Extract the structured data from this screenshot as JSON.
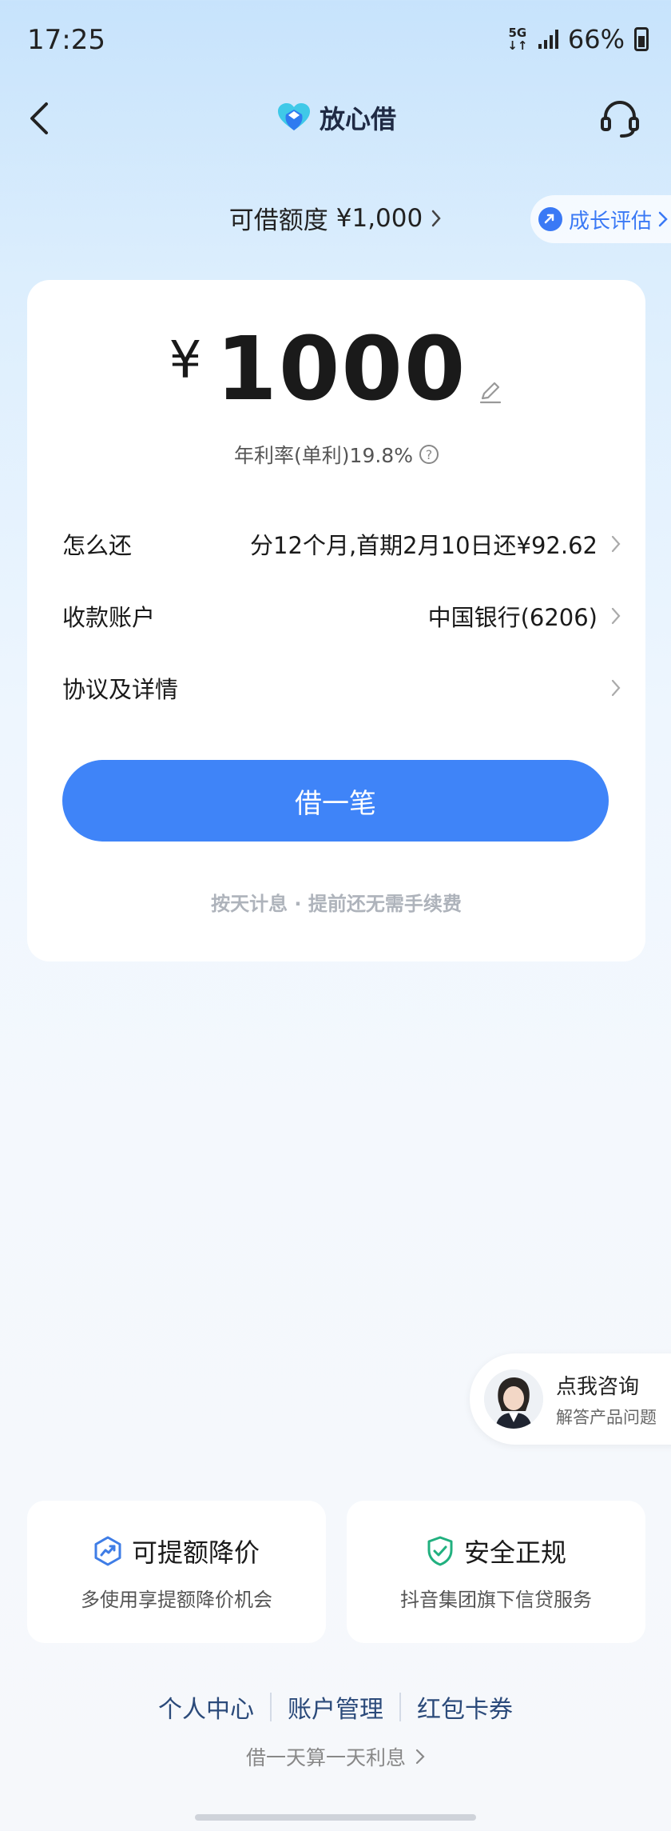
{
  "status": {
    "time": "17:25",
    "network": "5G",
    "battery": "66%"
  },
  "nav": {
    "title": "放心借",
    "back_icon": "chevron-left-icon",
    "service_icon": "headset-icon"
  },
  "quota": {
    "label": "可借额度",
    "amount": "¥1,000",
    "growth_label": "成长评估"
  },
  "loan": {
    "currency": "¥",
    "amount": "1000",
    "rate": "年利率(单利)19.8%",
    "rows": [
      {
        "label": "怎么还",
        "value": "分12个月,首期2月10日还¥92.62"
      },
      {
        "label": "收款账户",
        "value": "中国银行(6206)"
      },
      {
        "label": "协议及详情",
        "value": ""
      }
    ],
    "button": "借一笔",
    "note": "按天计息 · 提前还无需手续费"
  },
  "consult": {
    "title": "点我咨询",
    "subtitle": "解答产品问题"
  },
  "features": [
    {
      "title": "可提额降价",
      "desc": "多使用享提额降价机会",
      "icon": "growth-chart-icon"
    },
    {
      "title": "安全正规",
      "desc": "抖音集团旗下信贷服务",
      "icon": "shield-check-icon"
    }
  ],
  "links": [
    "个人中心",
    "账户管理",
    "红包卡券"
  ],
  "slogan": "借一天算一天利息",
  "colors": {
    "primary": "#3f84f8",
    "accent_green": "#21b07f",
    "link": "#2b4a7a"
  }
}
